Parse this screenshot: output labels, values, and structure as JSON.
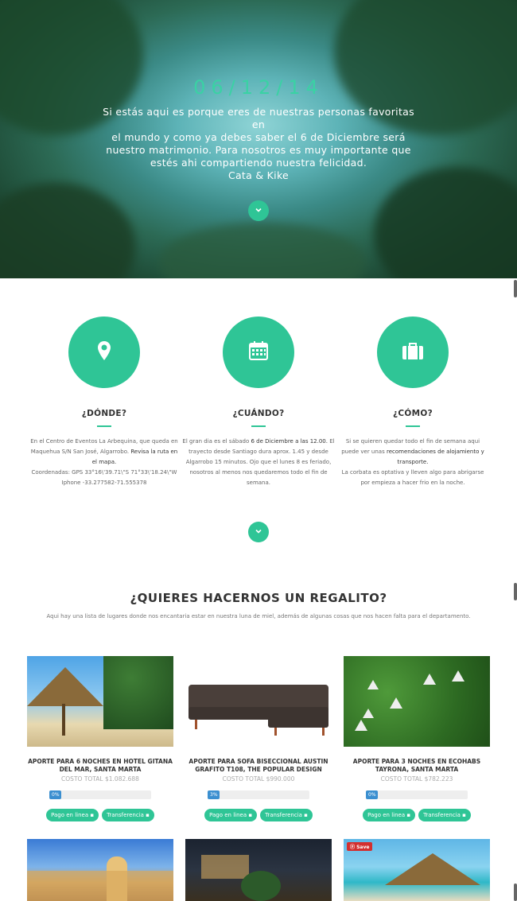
{
  "hero": {
    "date": "06/12/14",
    "message_lines": [
      "Si estás aqui es porque eres de nuestras personas favoritas en",
      "el mundo y como ya debes saber el 6 de Diciembre será",
      "nuestro matrimonio. Para nosotros es muy importante que",
      "estés ahi compartiendo nuestra felicidad."
    ],
    "signature": "Cata & Kike"
  },
  "features": [
    {
      "icon": "location-pin-icon",
      "title": "¿DÓNDE?",
      "text_a": "En el Centro de Eventos La Arbequina, que queda en Maquehua S/N San José, Algarrobo.",
      "link": "Revisa la ruta en el mapa.",
      "text_b": "Coordenadas: GPS 33°16\\'39.71\\\"S 71°33\\'18.24\\\"W Iphone -33.277582-71.555378"
    },
    {
      "icon": "calendar-icon",
      "title": "¿CUÁNDO?",
      "text_a": "El gran dia es el sábado",
      "link": "6 de Diciembre a las 12.00.",
      "text_b": "El trayecto desde Santiago dura aprox. 1.45 y desde Algarrobo 15 minutos. Ojo que el lunes 8 es feriado, nosotros al menos nos quedaremos todo el fin de semana."
    },
    {
      "icon": "suitcase-icon",
      "title": "¿CÓMO?",
      "text_a": "Si se quieren quedar todo el fin de semana aqui puede ver unas",
      "link": "recomendaciones de alojamiento y transporte.",
      "text_b": "La corbata es optativa y lleven algo para abrigarse por empieza a hacer frio en la noche."
    }
  ],
  "gifts": {
    "title": "¿QUIERES HACERNOS UN REGALITO?",
    "subtitle": "Aqui hay una lista de lugares donde nos encantaria estar en nuestra luna de miel, además de algunas cosas que nos hacen falta para el departamento.",
    "items": [
      {
        "name": "APORTE PARA 6 NOCHES EN HOTEL GITANA DEL MAR, SANTA MARTA",
        "cost": "COSTO TOTAL $1.082.688",
        "progress": "0%",
        "progress_value": 0,
        "pay_online": "Pago en linea",
        "transfer": "Transferencia"
      },
      {
        "name": "APORTE PARA SOFA BISECCIONAL AUSTIN GRAFITO T108, THE POPULAR DESIGN",
        "cost": "COSTO TOTAL $990.000",
        "progress": "3%",
        "progress_value": 3,
        "pay_online": "Pago en linea",
        "transfer": "Transferencia"
      },
      {
        "name": "APORTE PARA 3 NOCHES EN ECOHABS TAYRONA, SANTA MARTA",
        "cost": "COSTO TOTAL $782.223",
        "progress": "0%",
        "progress_value": 0,
        "pay_online": "Pago en linea",
        "transfer": "Transferencia"
      }
    ],
    "save_label": "Save"
  },
  "colors": {
    "accent": "#2fc596",
    "date": "#3ad2a4",
    "progress": "#3b8fd0"
  }
}
